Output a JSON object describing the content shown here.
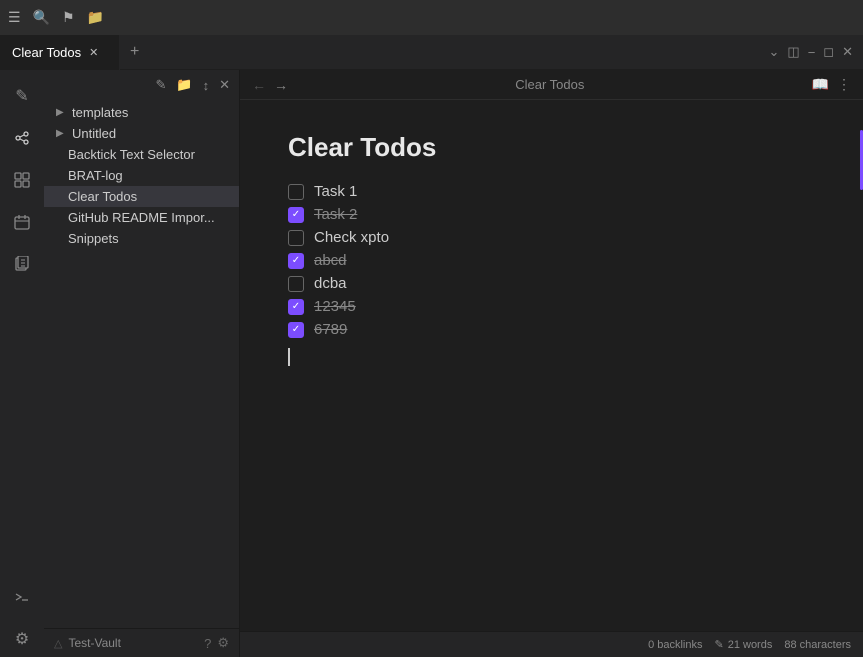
{
  "titlebar": {
    "icons": [
      "sidebar-icon",
      "search-icon",
      "bookmark-icon",
      "folder-icon"
    ]
  },
  "tabs": {
    "active": "Clear Todos",
    "items": [
      {
        "label": "Clear Todos",
        "active": true
      }
    ],
    "controls": [
      "chevron-down",
      "split-view",
      "minimize",
      "maximize",
      "close"
    ]
  },
  "sidebar_icons": {
    "items": [
      {
        "name": "new-note-icon",
        "symbol": "✎"
      },
      {
        "name": "graph-icon",
        "symbol": "⬡"
      },
      {
        "name": "plugin-icon",
        "symbol": "⊞"
      },
      {
        "name": "calendar-icon",
        "symbol": "⊡"
      },
      {
        "name": "files-icon",
        "symbol": "⧉"
      },
      {
        "name": "terminal-icon",
        "symbol": ">"
      },
      {
        "name": "settings-icon",
        "symbol": "⚙"
      }
    ]
  },
  "file_tree": {
    "header_icons": [
      "new-note",
      "new-folder",
      "sort",
      "collapse"
    ],
    "items": [
      {
        "label": "templates",
        "type": "folder",
        "collapsed": true,
        "indent": 0
      },
      {
        "label": "Untitled",
        "type": "folder",
        "collapsed": true,
        "indent": 0
      },
      {
        "label": "Backtick Text Selector",
        "type": "file",
        "indent": 1
      },
      {
        "label": "BRAT-log",
        "type": "file",
        "indent": 1
      },
      {
        "label": "Clear Todos",
        "type": "file",
        "indent": 1,
        "active": true
      },
      {
        "label": "GitHub README Impor...",
        "type": "file",
        "indent": 1
      },
      {
        "label": "Snippets",
        "type": "file",
        "indent": 1
      }
    ],
    "footer": {
      "vault_name": "Test-Vault",
      "icons": [
        "help-icon",
        "settings-icon"
      ]
    }
  },
  "editor": {
    "back_btn": "←",
    "forward_btn": "→",
    "title_bar": "Clear Todos",
    "toolbar_icons": [
      "book-open",
      "more-options"
    ],
    "doc_title": "Clear Todos",
    "todos": [
      {
        "label": "Task 1",
        "checked": false
      },
      {
        "label": "Task 2",
        "checked": true
      },
      {
        "label": "Check xpto",
        "checked": false
      },
      {
        "label": "abcd",
        "checked": true
      },
      {
        "label": "dcba",
        "checked": false
      },
      {
        "label": "12345",
        "checked": true
      },
      {
        "label": "6789",
        "checked": true
      }
    ]
  },
  "statusbar": {
    "backlinks": "0 backlinks",
    "pencil_icon": "✎",
    "words": "21 words",
    "characters": "88 characters"
  }
}
